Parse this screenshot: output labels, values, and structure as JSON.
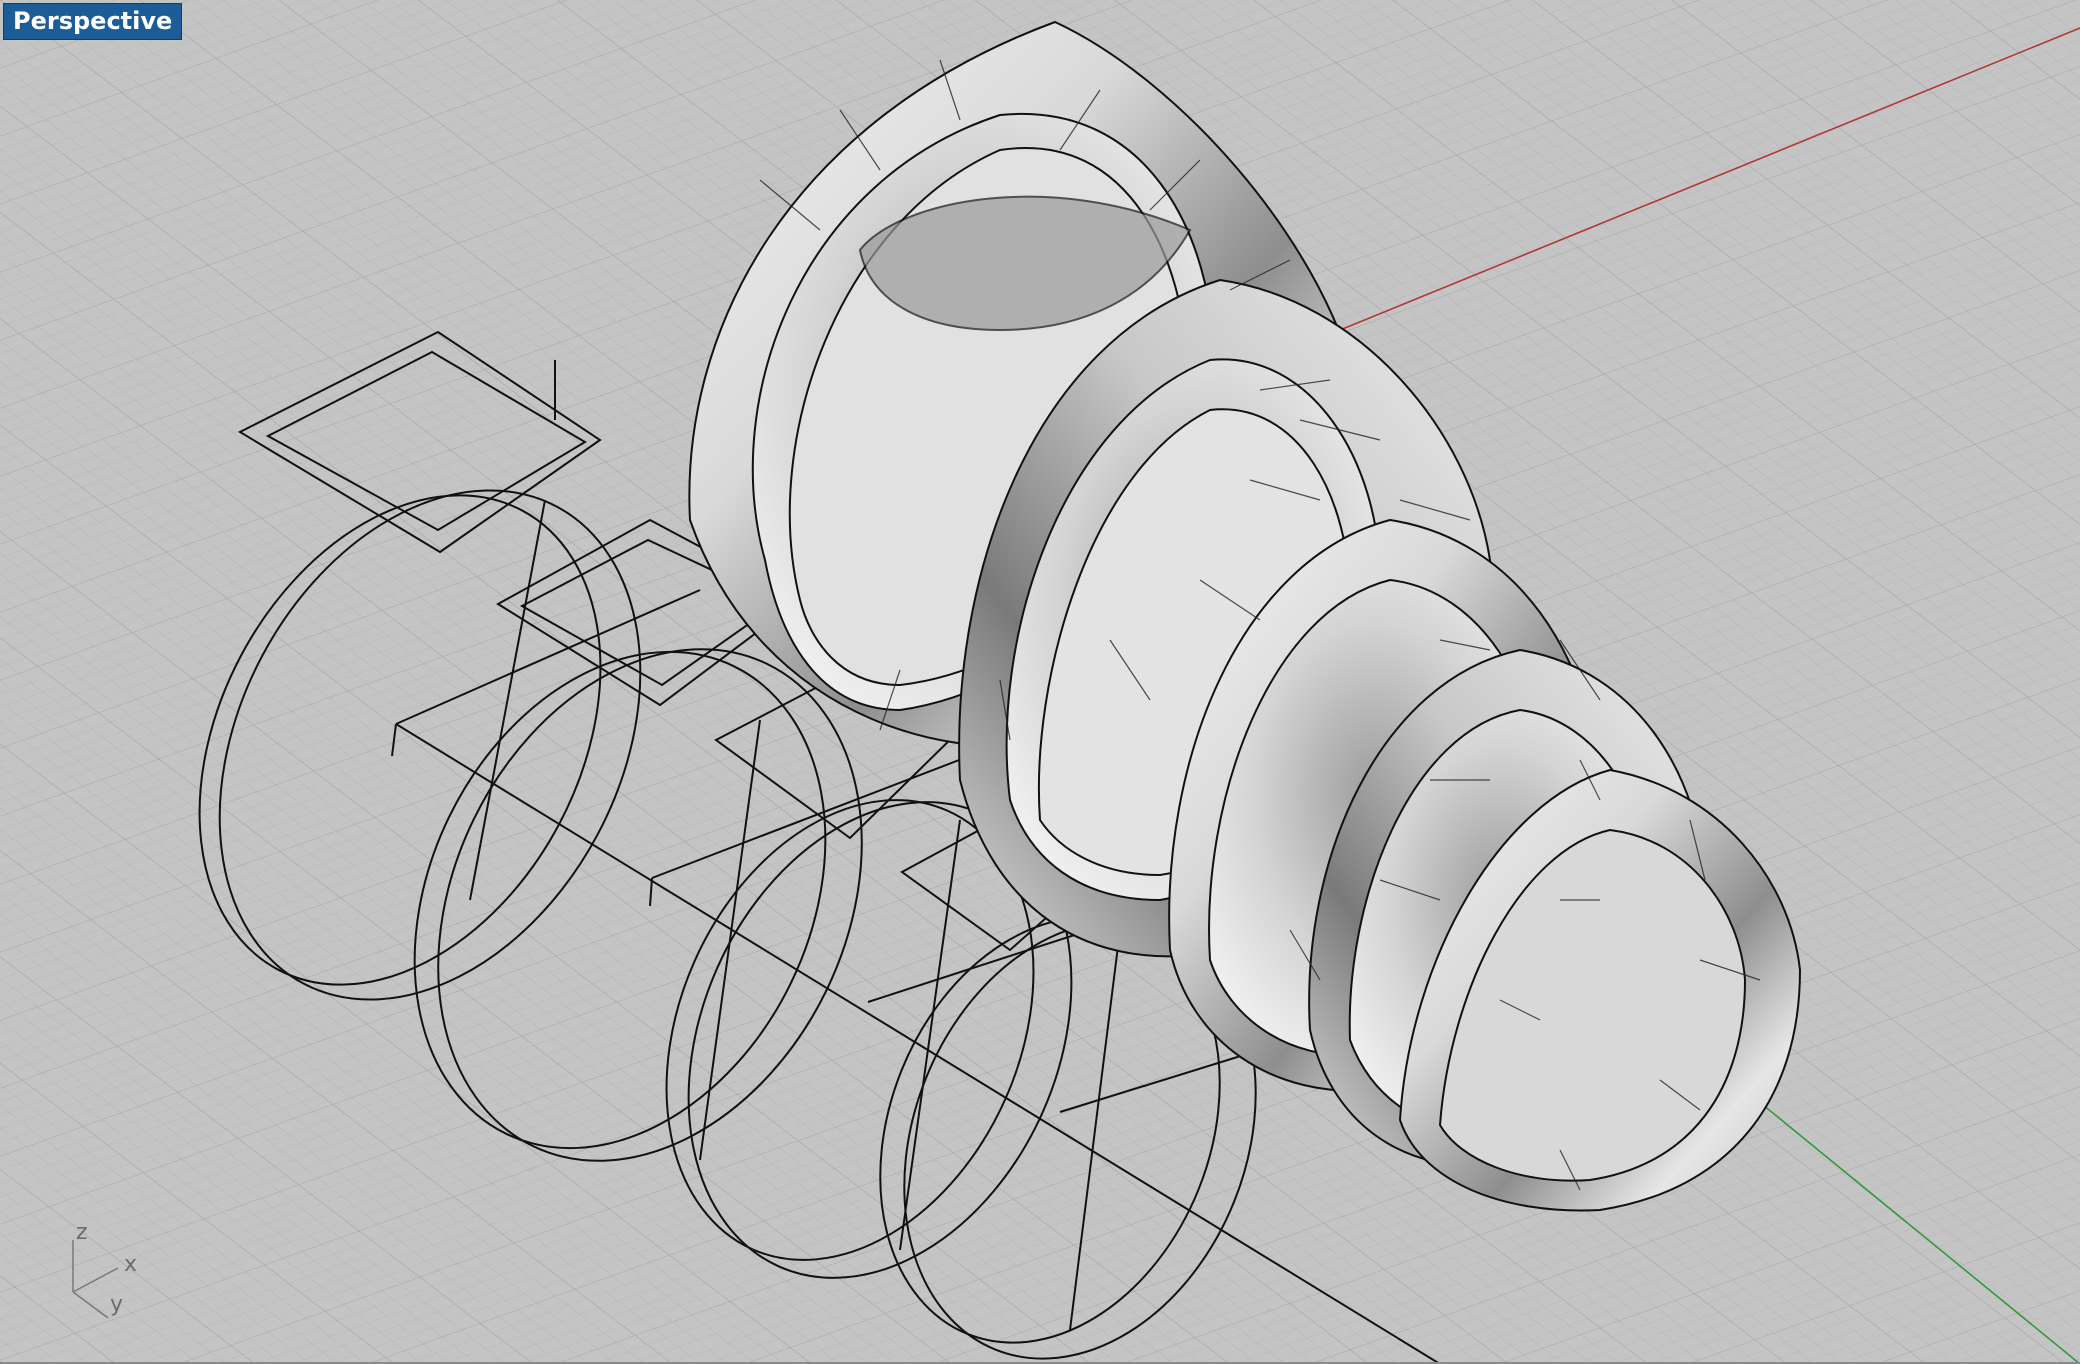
{
  "viewport": {
    "title": "Perspective"
  },
  "axis_widget": {
    "z": "z",
    "x": "x",
    "y": "y"
  },
  "colors": {
    "background": "#c4c4c4",
    "grid_minor": "#b4b4b4",
    "grid_major": "#a8a8a8",
    "x_axis": "#b03a35",
    "y_axis": "#2f9a3a",
    "curves": "#111111",
    "title_bg": "#1d5d97"
  },
  "icons": [
    "axis-triad-icon"
  ]
}
